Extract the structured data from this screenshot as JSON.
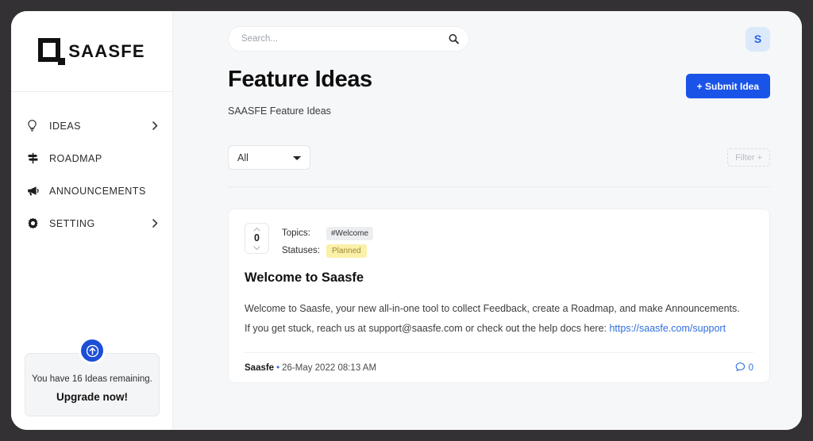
{
  "brand": {
    "logo_text": "SAASFE",
    "logo_icon": "saasfe-square-logo"
  },
  "sidebar": {
    "items": [
      {
        "label": "IDEAS",
        "icon": "lightbulb-icon",
        "chevron": true
      },
      {
        "label": "ROADMAP",
        "icon": "signpost-icon",
        "chevron": false
      },
      {
        "label": "ANNOUNCEMENTS",
        "icon": "megaphone-icon",
        "chevron": false
      },
      {
        "label": "SETTING",
        "icon": "gear-icon",
        "chevron": true
      }
    ],
    "upgrade": {
      "badge_icon": "arrow-up-circle-icon",
      "message": "You have 16 Ideas remaining.",
      "cta": "Upgrade now!"
    }
  },
  "topbar": {
    "search_placeholder": "Search...",
    "search_value": "",
    "search_icon": "search-icon",
    "avatar_initial": "S"
  },
  "page": {
    "title": "Feature Ideas",
    "subtitle": "SAASFE Feature Ideas",
    "submit_label": "+ Submit Idea"
  },
  "filters": {
    "selected": "All",
    "options": [
      "All"
    ],
    "filter_label": "Filter +"
  },
  "ideas": [
    {
      "votes": "0",
      "topics_label": "Topics:",
      "topic": "#Welcome",
      "statuses_label": "Statuses:",
      "status": "Planned",
      "title": "Welcome to Saasfe",
      "body_line_1": "Welcome to Saasfe, your new all-in-one tool to collect Feedback, create a Roadmap, and make Announcements.",
      "body_line_2_prefix": "If you get stuck, reach us at support@saasfe.com or check out the help docs here: ",
      "body_link": "https://saasfe.com/support",
      "author": "Saasfe",
      "separator": "•",
      "timestamp": "26-May 2022 08:13 AM",
      "comment_count": "0",
      "comment_icon": "comment-bubble-icon"
    }
  ],
  "colors": {
    "accent_blue": "#1a53e8",
    "link_blue": "#2f6fe0",
    "status_yellow": "#fbf0a8",
    "frame_dark": "#333134"
  }
}
